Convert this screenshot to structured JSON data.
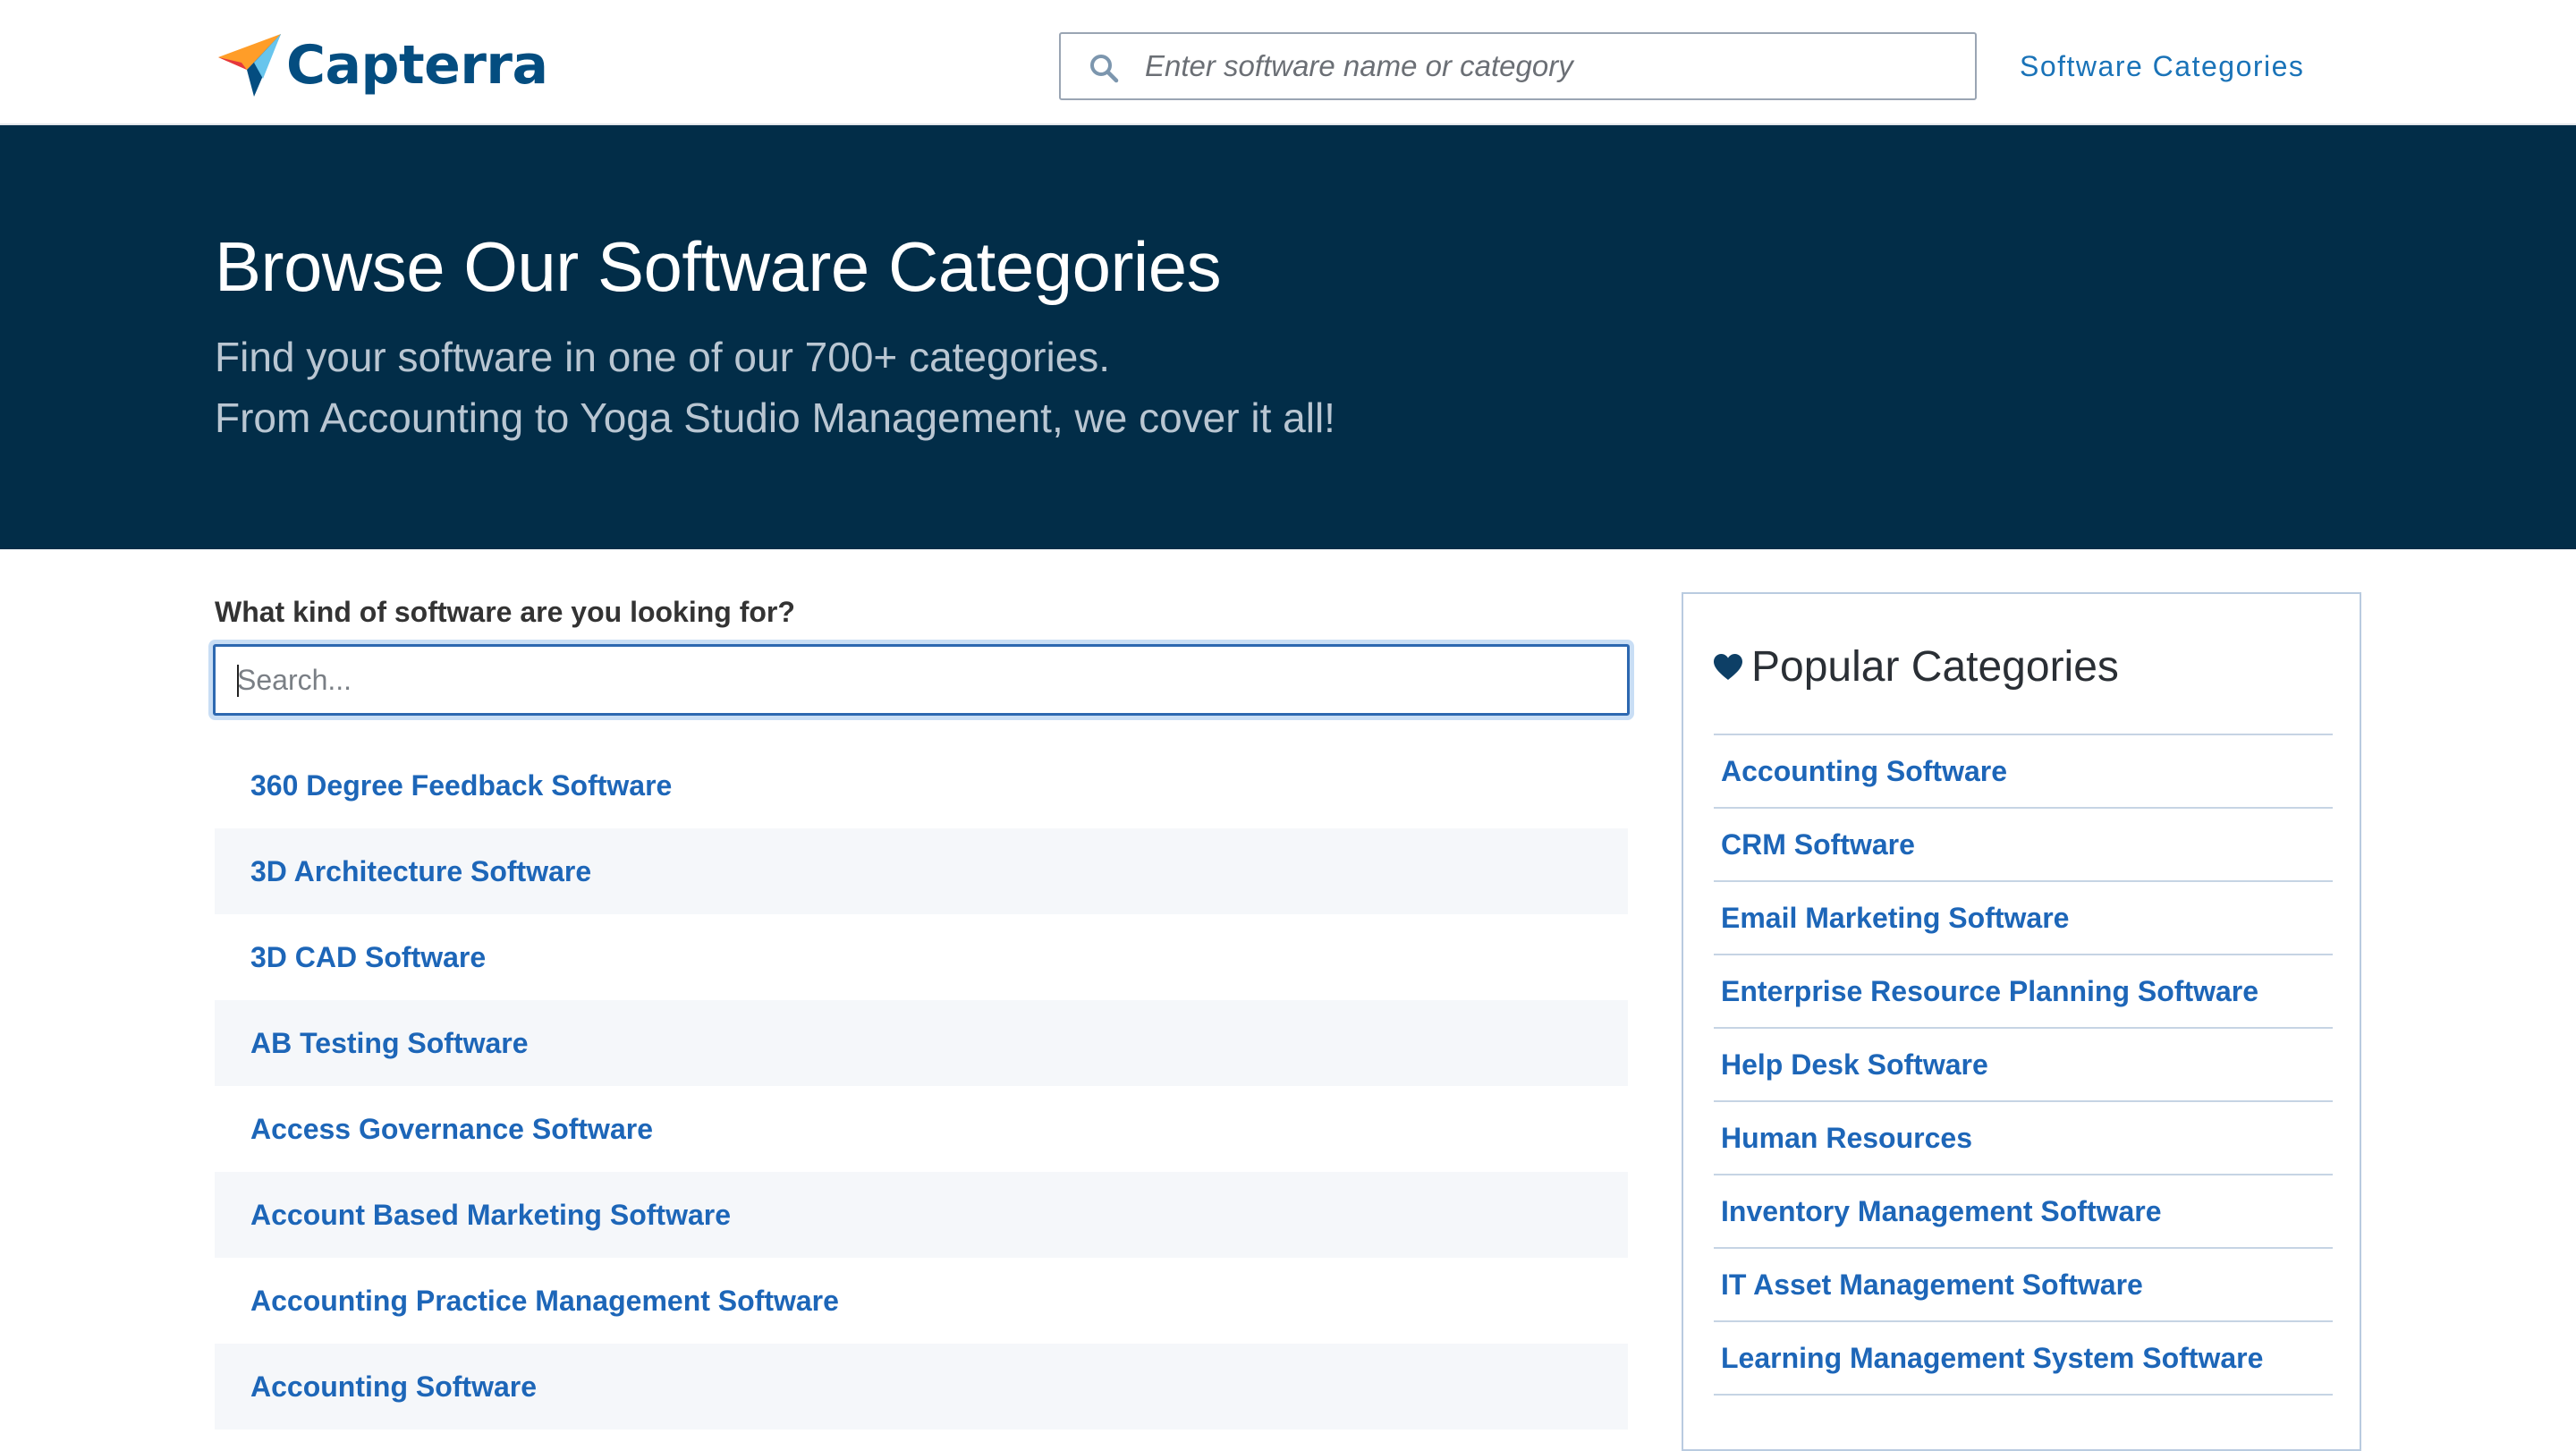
{
  "header": {
    "logo_text": "Capterra",
    "search_placeholder": "Enter software name or category",
    "nav_link": "Software Categories"
  },
  "hero": {
    "title": "Browse Our Software Categories",
    "subtitle_line1": "Find your software in one of our 700+ categories.",
    "subtitle_line2": "From Accounting to Yoga Studio Management, we cover it all!"
  },
  "main": {
    "question": "What kind of software are you looking for?",
    "search_placeholder": "Search...",
    "categories": [
      "360 Degree Feedback Software",
      "3D Architecture Software",
      "3D CAD Software",
      "AB Testing Software",
      "Access Governance Software",
      "Account Based Marketing Software",
      "Accounting Practice Management Software",
      "Accounting Software"
    ]
  },
  "sidebar": {
    "title": "Popular Categories",
    "items": [
      "Accounting Software",
      "CRM Software",
      "Email Marketing Software",
      "Enterprise Resource Planning Software",
      "Help Desk Software",
      "Human Resources",
      "Inventory Management Software",
      "IT Asset Management Software",
      "Learning Management System Software"
    ]
  },
  "colors": {
    "hero_background": "#022d48",
    "brand_blue": "#044d80",
    "link_blue": "#1d66b8",
    "logo_orange": "#ff9d28",
    "logo_red": "#e6373c",
    "logo_light_blue": "#68c5ed"
  },
  "icons": {
    "logo": "capterra-arrow-logo-icon",
    "top_search": "search-icon",
    "popular": "heart-icon"
  }
}
